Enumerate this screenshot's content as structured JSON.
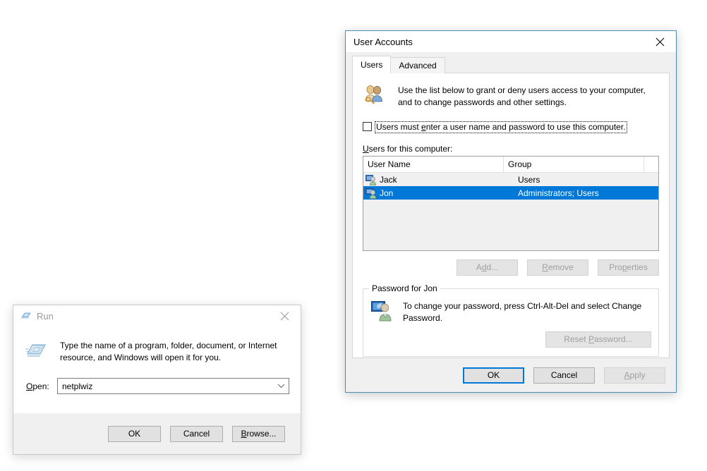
{
  "user_accounts": {
    "title": "User Accounts",
    "close_icon": "close-icon",
    "tabs": [
      {
        "label": "Users",
        "active": true
      },
      {
        "label": "Advanced",
        "active": false
      }
    ],
    "intro": {
      "icon": "users-key-icon",
      "line1": "Use the list below to grant or deny users access to your computer,",
      "line2": "and to change passwords and other settings."
    },
    "checkbox": {
      "checked": false,
      "label_before": "Users must ",
      "label_mnemonic": "e",
      "label_after": "nter a user name and password to use this computer."
    },
    "list_label_mnemonic": "U",
    "list_label_rest": "sers for this computer:",
    "columns": [
      "User Name",
      "Group",
      ""
    ],
    "rows": [
      {
        "name": "Jack",
        "group": "Users",
        "selected": false,
        "icon": "user-icon"
      },
      {
        "name": "Jon",
        "group": "Administrators; Users",
        "selected": true,
        "icon": "user-icon"
      }
    ],
    "list_buttons": [
      {
        "before": "A",
        "mnemonic": "d",
        "after": "d...",
        "disabled": true
      },
      {
        "before": "",
        "mnemonic": "R",
        "after": "emove",
        "disabled": true
      },
      {
        "before": "Pro",
        "mnemonic": "p",
        "after": "erties",
        "disabled": true
      }
    ],
    "password_group": {
      "title": "Password for Jon",
      "icon": "user-monitor-icon",
      "line1": "To change your password, press Ctrl-Alt-Del and select Change",
      "line2": "Password.",
      "button": {
        "before": "Reset ",
        "mnemonic": "P",
        "after": "assword...",
        "disabled": true
      }
    },
    "footer_buttons": [
      {
        "before": "OK",
        "mnemonic": "",
        "after": "",
        "disabled": false,
        "default": true
      },
      {
        "before": "Cancel",
        "mnemonic": "",
        "after": "",
        "disabled": false,
        "default": false
      },
      {
        "before": "",
        "mnemonic": "A",
        "after": "pply",
        "disabled": true,
        "default": false
      }
    ],
    "accent_color": "#0078d7",
    "border_color": "#4c8dae"
  },
  "run_dialog": {
    "title": "Run",
    "title_icon": "run-icon",
    "close_icon": "close-icon",
    "intro": {
      "icon": "run-large-icon",
      "line1": "Type the name of a program, folder, document, or Internet",
      "line2": "resource, and Windows will open it for you."
    },
    "open_label_mnemonic": "O",
    "open_label_rest": "pen:",
    "open_value": "netplwiz",
    "open_placeholder": "",
    "dropdown_icon": "chevron-down-icon",
    "buttons": [
      {
        "before": "OK",
        "mnemonic": "",
        "after": ""
      },
      {
        "before": "Cancel",
        "mnemonic": "",
        "after": ""
      },
      {
        "before": "",
        "mnemonic": "B",
        "after": "rowse..."
      }
    ]
  }
}
